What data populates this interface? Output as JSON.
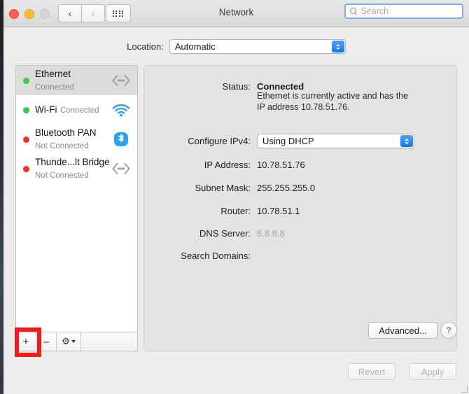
{
  "window": {
    "title": "Network",
    "traffic_lights": [
      "close",
      "minimize",
      "zoom-disabled"
    ],
    "nav_back": "‹",
    "nav_forward": "›",
    "grid_icon": "show-all-icon"
  },
  "search": {
    "placeholder": "Search",
    "value": "",
    "icon": "search-icon"
  },
  "location": {
    "label": "Location:",
    "value": "Automatic",
    "options": [
      "Automatic"
    ]
  },
  "sidebar": {
    "services": [
      {
        "name": "Ethernet",
        "status": "Connected",
        "status_color": "#3ccf4e",
        "icon": "ethernet-icon",
        "selected": true
      },
      {
        "name": "Wi-Fi",
        "status": "Connected",
        "status_color": "#3ccf4e",
        "icon": "wifi-icon",
        "selected": false
      },
      {
        "name": "Bluetooth PAN",
        "status": "Not Connected",
        "status_color": "#f0342c",
        "icon": "bluetooth-icon",
        "selected": false
      },
      {
        "name": "Thunde...lt Bridge",
        "status": "Not Connected",
        "status_color": "#f0342c",
        "icon": "ethernet-icon",
        "selected": false
      }
    ],
    "toolbar": {
      "add_label": "+",
      "remove_label": "–",
      "action_icon": "gear-icon"
    },
    "highlight_color": "#f01b1b"
  },
  "detail": {
    "status_label": "Status:",
    "status_value": "Connected",
    "status_description": "Ethernet is currently active and has the IP address 10.78.51.76.",
    "configure_label": "Configure IPv4:",
    "configure_value": "Using DHCP",
    "configure_options": [
      "Using DHCP"
    ],
    "fields": [
      {
        "label": "IP Address:",
        "value": "10.78.51.76",
        "dim": false
      },
      {
        "label": "Subnet Mask:",
        "value": "255.255.255.0",
        "dim": false
      },
      {
        "label": "Router:",
        "value": "10.78.51.1",
        "dim": false
      },
      {
        "label": "DNS Server:",
        "value": "8.8.8.8",
        "dim": true
      },
      {
        "label": "Search Domains:",
        "value": "",
        "dim": false
      }
    ],
    "advanced_label": "Advanced...",
    "help_label": "?"
  },
  "footer": {
    "revert_label": "Revert",
    "apply_label": "Apply"
  },
  "colors": {
    "accent_blue": "#1178f0",
    "focus_ring": "#7cacea",
    "connected_green": "#3ccf4e",
    "disconnected_red": "#f0342c",
    "highlight_red": "#f01b1b"
  }
}
